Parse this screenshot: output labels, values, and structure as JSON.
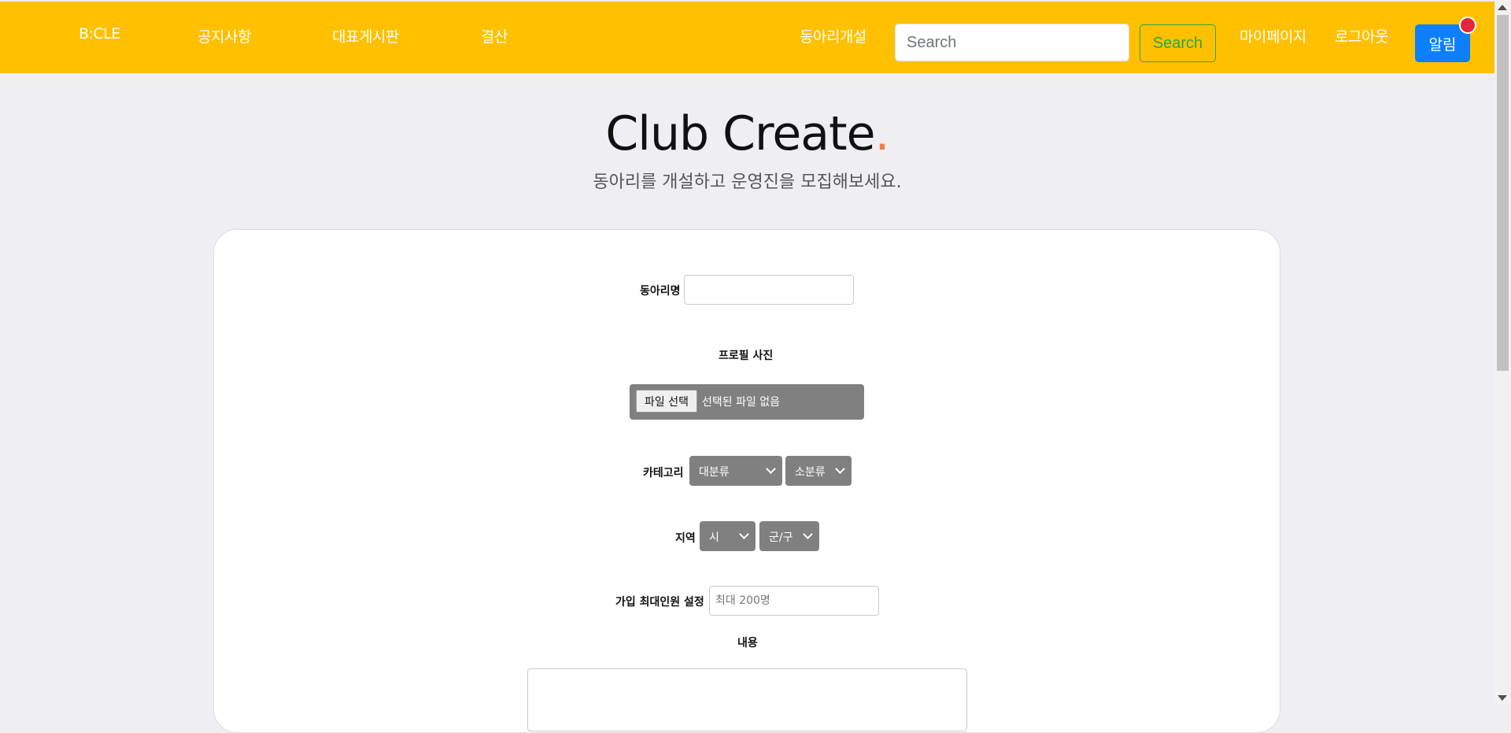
{
  "nav": {
    "brand": "B:CLE",
    "links": [
      "공지사항",
      "대표게시판",
      "결산"
    ],
    "create_club": "동아리개설",
    "search_placeholder": "Search",
    "search_button": "Search",
    "mypage": "마이페이지",
    "logout": "로그아웃",
    "alarm": "알림"
  },
  "hero": {
    "title": "Club Create",
    "title_dot": ".",
    "subtitle": "동아리를 개설하고 운영진을 모집해보세요."
  },
  "form": {
    "club_name_label": "동아리명",
    "club_name_value": "",
    "profile_label": "프로필 사진",
    "file_button": "파일 선택",
    "file_status": "선택된 파일 없음",
    "category_label": "카테고리",
    "category_major": "대분류",
    "category_minor": "소분류",
    "region_label": "지역",
    "region_city": "시",
    "region_district": "군/구",
    "max_members_label": "가입 최대인원 설정",
    "max_members_placeholder": "최대 200명",
    "content_label": "내용"
  },
  "colors": {
    "navbar": "#ffc000",
    "background": "#efeef3",
    "accent_dot": "#f47c3c",
    "alarm": "#0d7fff",
    "search_button": "#28a745"
  }
}
